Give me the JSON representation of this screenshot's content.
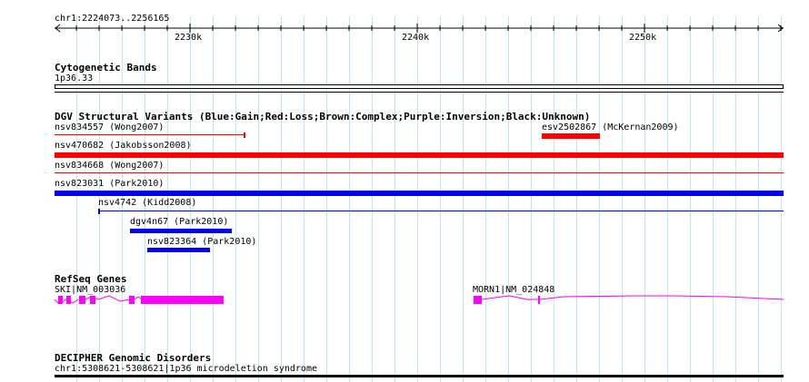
{
  "ruler": {
    "range_label": "chr1:2224073..2256165",
    "ticks": [
      "2230k",
      "2240k",
      "2250k"
    ]
  },
  "tracks": {
    "cytoband": {
      "title": "Cytogenetic Bands",
      "label": "1p36.33"
    },
    "dgv": {
      "title": "DGV Structural Variants (Blue:Gain;Red:Loss;Brown:Complex;Purple:Inversion;Black:Unknown)",
      "features": [
        {
          "label": "nsv834557 (Wong2007)",
          "type": "Loss"
        },
        {
          "label": "esv2502867 (McKernan2009)",
          "type": "Loss"
        },
        {
          "label": "nsv470682 (Jakobsson2008)",
          "type": "Loss"
        },
        {
          "label": "nsv834668 (Wong2007)",
          "type": "Loss"
        },
        {
          "label": "nsv823031 (Park2010)",
          "type": "Gain"
        },
        {
          "label": "nsv4742 (Kidd2008)",
          "type": "Gain"
        },
        {
          "label": "dgv4n67 (Park2010)",
          "type": "Gain"
        },
        {
          "label": "nsv823364 (Park2010)",
          "type": "Gain"
        }
      ]
    },
    "refseq": {
      "title": "RefSeq Genes",
      "genes": [
        {
          "label": "SKI|NM_003036"
        },
        {
          "label": "MORN1|NM_024848"
        }
      ]
    },
    "decipher": {
      "title": "DECIPHER Genomic Disorders",
      "label": "chr1:5308621-5308621|1p36 microdeletion syndrome"
    }
  },
  "colors": {
    "gain": "#0000ee",
    "loss": "#ff0000",
    "gene": "#ff00ff",
    "grid": "#bfe4f2"
  }
}
